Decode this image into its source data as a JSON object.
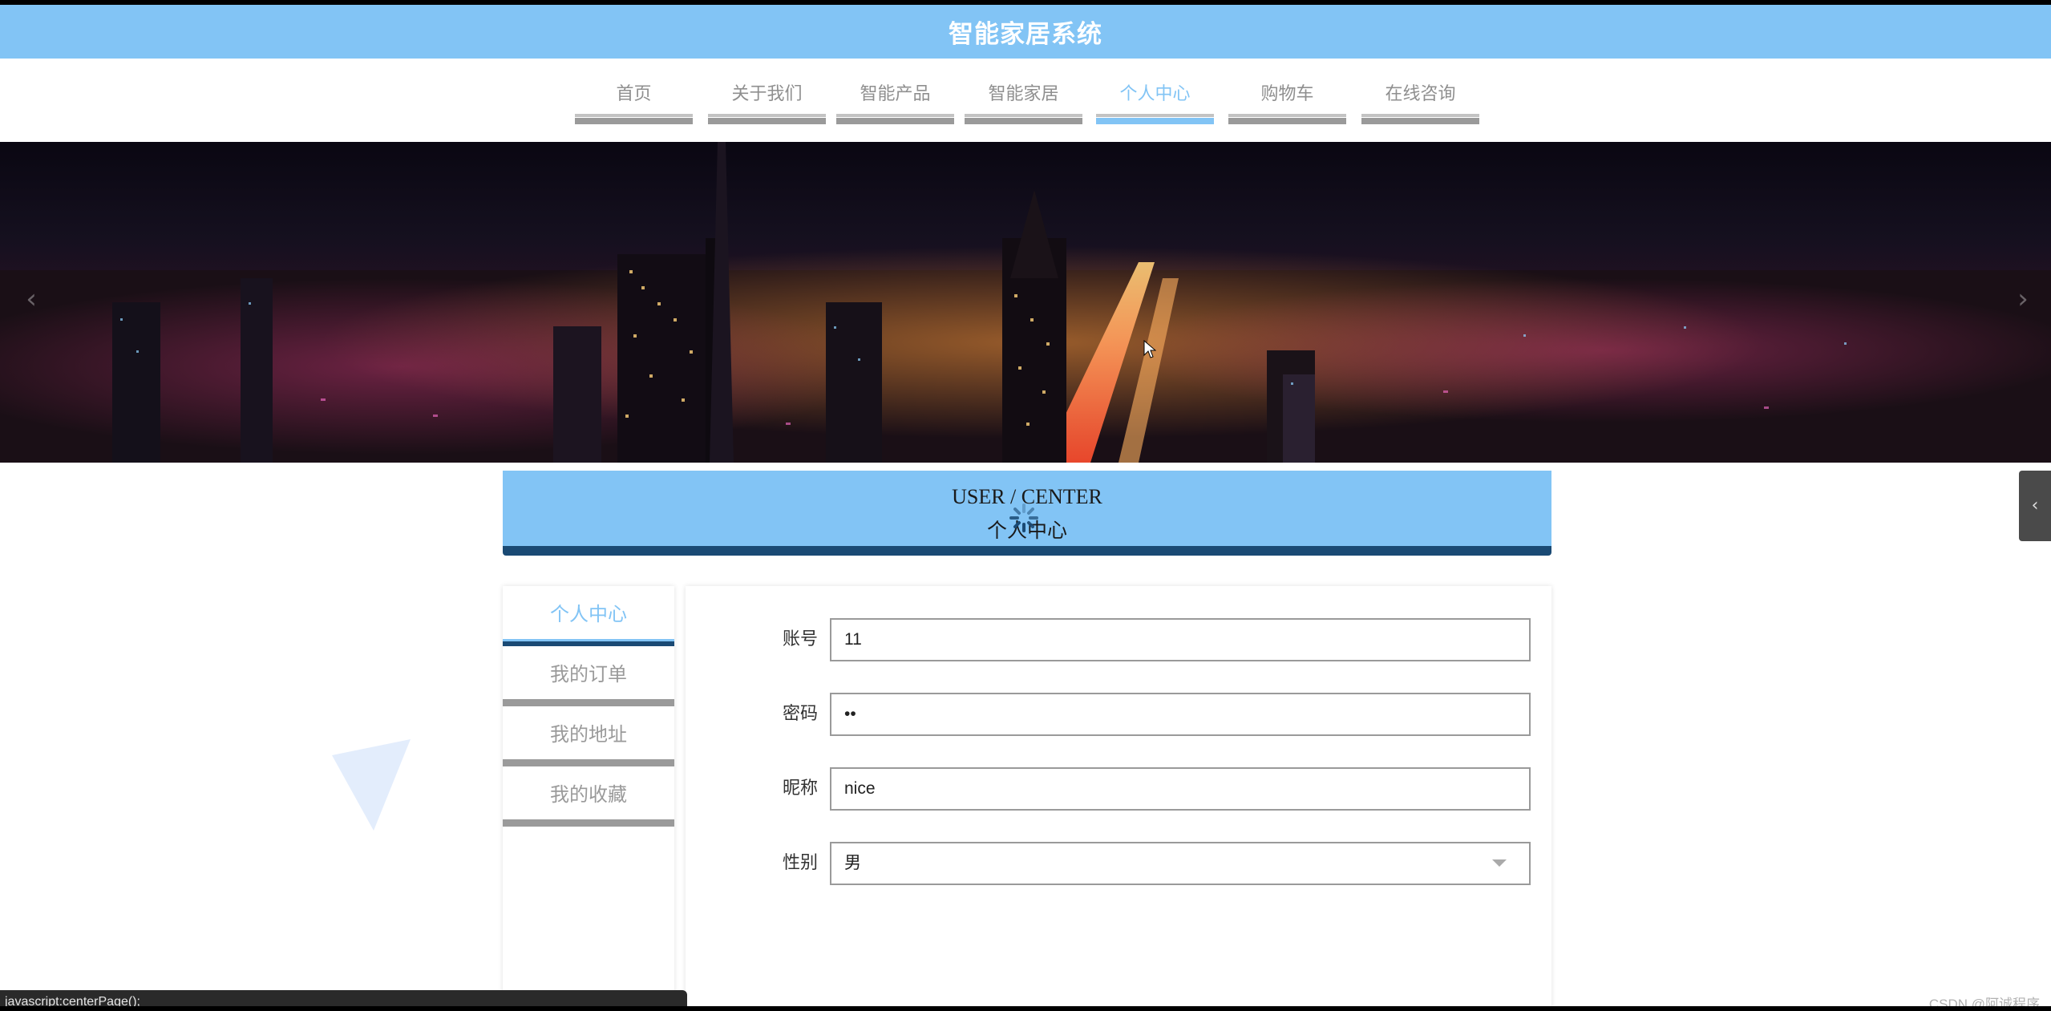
{
  "header": {
    "title": "智能家居系统"
  },
  "nav": {
    "items": [
      {
        "label": "首页"
      },
      {
        "label": "关于我们"
      },
      {
        "label": "智能产品"
      },
      {
        "label": "智能家居"
      },
      {
        "label": "个人中心",
        "active": true
      },
      {
        "label": "购物车"
      },
      {
        "label": "在线咨询"
      }
    ]
  },
  "banner": {
    "prev_icon": "chevron-left-icon",
    "next_icon": "chevron-right-icon"
  },
  "section": {
    "title_en": "USER / CENTER",
    "title_zh": "个人中心"
  },
  "side_menu": {
    "items": [
      {
        "label": "个人中心",
        "active": true
      },
      {
        "label": "我的订单"
      },
      {
        "label": "我的地址"
      },
      {
        "label": "我的收藏"
      }
    ]
  },
  "form": {
    "account": {
      "label": "账号",
      "value": "11"
    },
    "password": {
      "label": "密码",
      "value": "••"
    },
    "nickname": {
      "label": "昵称",
      "value": "nice"
    },
    "gender": {
      "label": "性别",
      "value": "男"
    }
  },
  "status_bar": {
    "text": "javascript:centerPage();"
  },
  "watermark": "CSDN @阿诚程序",
  "colors": {
    "accent": "#82c4f5",
    "dark_accent": "#1a4a74",
    "muted": "#9a9a9a"
  }
}
